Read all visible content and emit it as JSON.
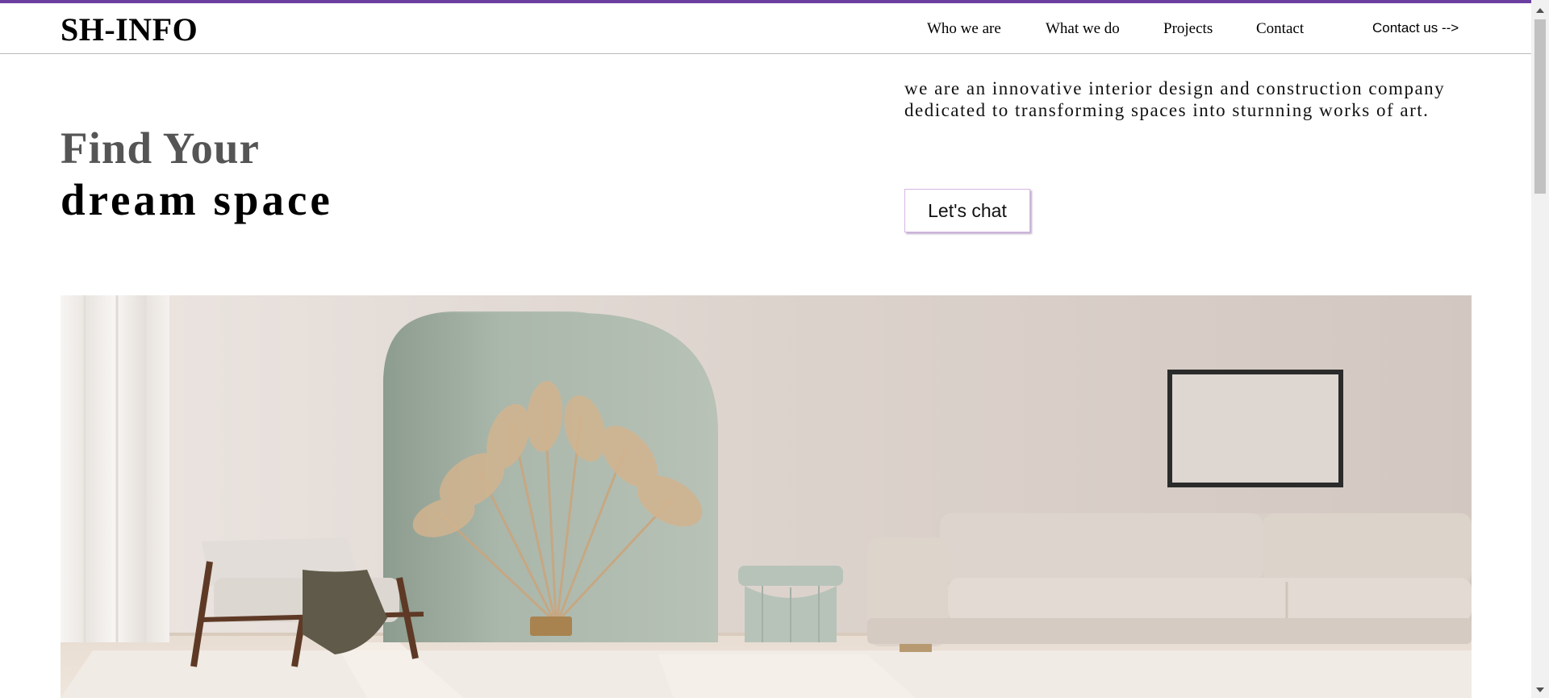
{
  "header": {
    "logo": "SH-INFO",
    "nav": [
      {
        "label": "Who we are"
      },
      {
        "label": "What we do"
      },
      {
        "label": "Projects"
      },
      {
        "label": "Contact"
      }
    ],
    "cta": "Contact us -->"
  },
  "hero": {
    "title_line1": "Find Your",
    "title_line2": "dream space",
    "description": "we are an innovative interior design and construction company dedicated to transforming spaces into sturnning works of art.",
    "chat_button": "Let's chat"
  },
  "colors": {
    "accent_bar": "#6b3fa0",
    "title_gray": "#555555"
  }
}
